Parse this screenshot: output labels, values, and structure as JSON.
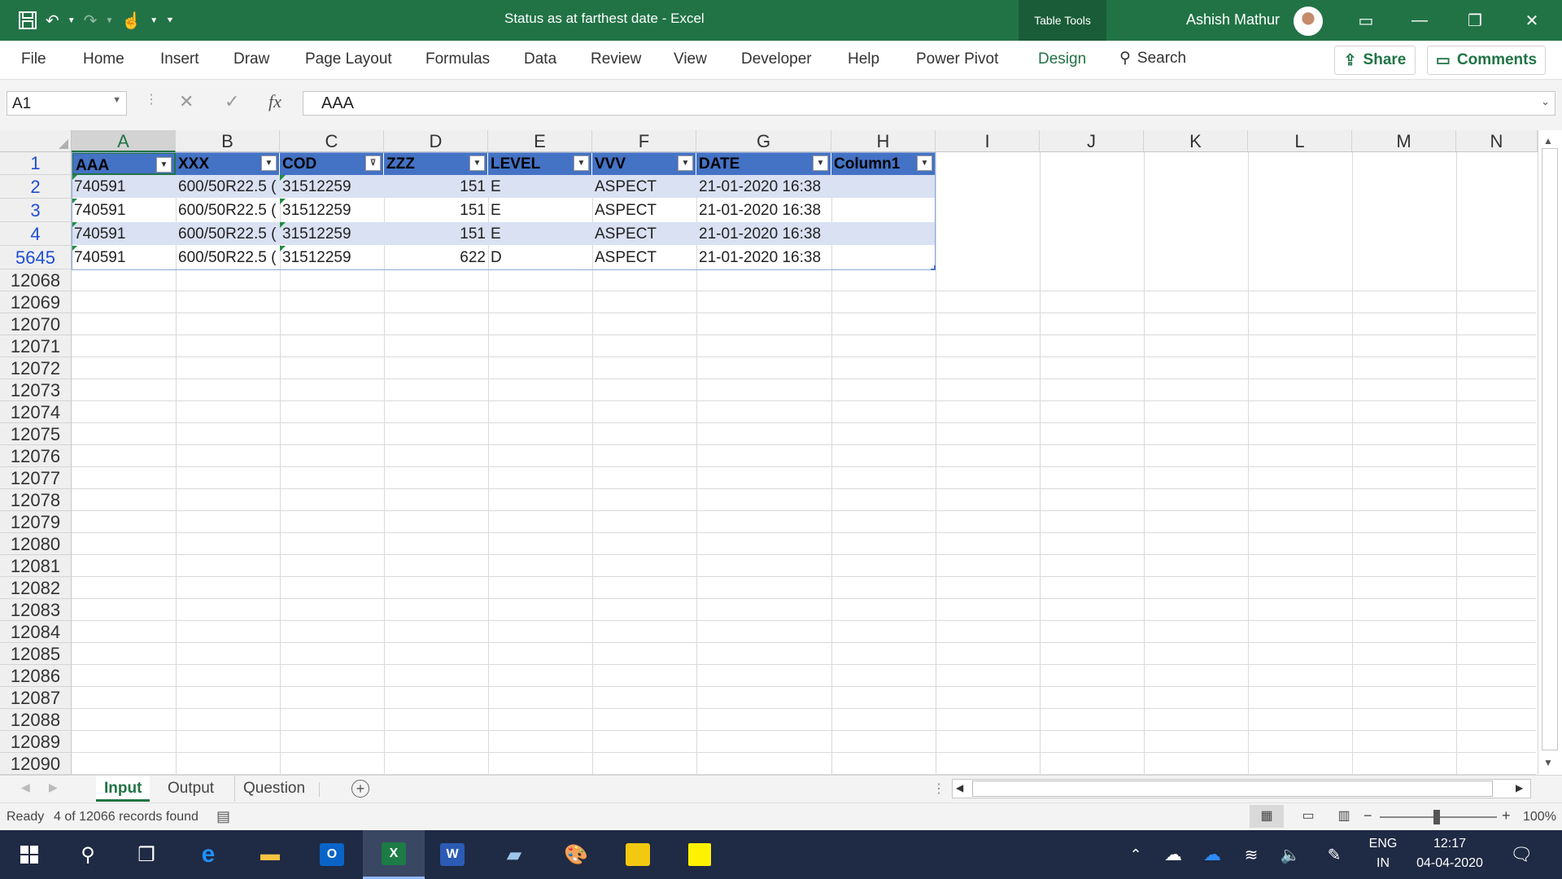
{
  "titlebar": {
    "title": "Status as at farthest date  -  Excel",
    "context_tab": "Table Tools",
    "user": "Ashish Mathur"
  },
  "ribbon": {
    "tabs": [
      "File",
      "Home",
      "Insert",
      "Draw",
      "Page Layout",
      "Formulas",
      "Data",
      "Review",
      "View",
      "Developer",
      "Help",
      "Power Pivot",
      "Design"
    ],
    "active_tab": "Design",
    "search_label": "Search",
    "share_label": "Share",
    "comments_label": "Comments"
  },
  "formula_bar": {
    "name_box": "A1",
    "formula": "AAA"
  },
  "grid": {
    "columns": [
      "A",
      "B",
      "C",
      "D",
      "E",
      "F",
      "G",
      "H",
      "I",
      "J",
      "K",
      "L",
      "M",
      "N"
    ],
    "table_headers": [
      "AAA",
      "XXX",
      "COD",
      "ZZZ",
      "LEVEL",
      "VVV",
      "DATE",
      "Column1"
    ],
    "rows": [
      {
        "row_num": "2",
        "cells": [
          "740591",
          "600/50R22.5 (",
          "31512259",
          "151",
          "E",
          "ASPECT",
          "21-01-2020 16:38",
          ""
        ]
      },
      {
        "row_num": "3",
        "cells": [
          "740591",
          "600/50R22.5 (",
          "31512259",
          "151",
          "E",
          "ASPECT",
          "21-01-2020 16:38",
          ""
        ]
      },
      {
        "row_num": "4",
        "cells": [
          "740591",
          "600/50R22.5 (",
          "31512259",
          "151",
          "E",
          "ASPECT",
          "21-01-2020 16:38",
          ""
        ]
      },
      {
        "row_num": "5645",
        "cells": [
          "740591",
          "600/50R22.5 (",
          "31512259",
          "622",
          "D",
          "ASPECT",
          "21-01-2020 16:38",
          ""
        ]
      }
    ],
    "empty_rows": [
      "12068",
      "12069",
      "12070",
      "12071",
      "12072",
      "12073",
      "12074",
      "12075",
      "12076",
      "12077",
      "12078",
      "12079",
      "12080",
      "12081",
      "12082",
      "12083",
      "12084",
      "12085",
      "12086",
      "12087",
      "12088",
      "12089",
      "12090"
    ]
  },
  "sheets": {
    "tabs": [
      "Input",
      "Output",
      "Question"
    ],
    "active": "Input"
  },
  "status": {
    "ready": "Ready",
    "records": "4 of 12066 records found",
    "zoom": "100%"
  },
  "taskbar": {
    "lang_top": "ENG",
    "lang_bottom": "IN",
    "time": "12:17",
    "date": "04-04-2020"
  },
  "colors": {
    "excel_green": "#217346",
    "table_header": "#4472c4",
    "table_band": "#d9e1f2",
    "row_filter_number": "#1f4ed6"
  }
}
